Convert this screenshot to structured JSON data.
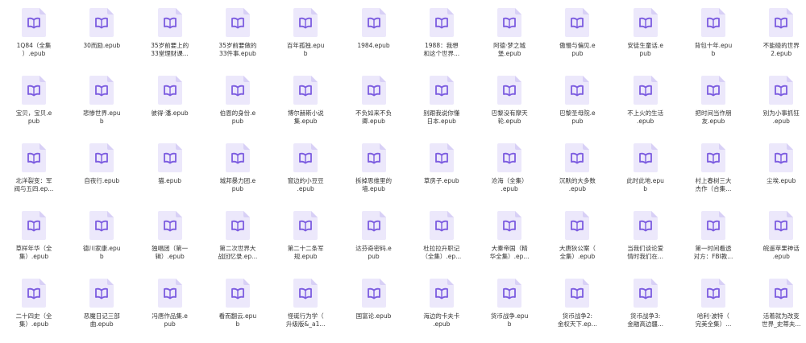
{
  "files": [
    {
      "name": "1Q84（全集\n）.epub"
    },
    {
      "name": "30而励.epub"
    },
    {
      "name": "35岁前要上的\n33堂理财课..."
    },
    {
      "name": "35岁前要做的\n33件事.epub"
    },
    {
      "name": "百年孤独.epu\nb"
    },
    {
      "name": "1984.epub"
    },
    {
      "name": "1988：我想\n和这个世界..."
    },
    {
      "name": "阿德·梦之城\n堡.epub"
    },
    {
      "name": "傲慢与偏见.e\npub"
    },
    {
      "name": "安徒生童话.e\npub"
    },
    {
      "name": "背包十年.epu\nb"
    },
    {
      "name": "不能碰的世界\n2.epub"
    },
    {
      "name": "宝贝，宝贝.e\npub"
    },
    {
      "name": "悲惨世界.epu\nb"
    },
    {
      "name": "彼得·潘.epub"
    },
    {
      "name": "伯恩的身份.e\npub"
    },
    {
      "name": "博尔赫斯小说\n集.epub"
    },
    {
      "name": "不负如来不负\n卿.epub"
    },
    {
      "name": "别跟我说你懂\n日本.epub"
    },
    {
      "name": "巴黎没有摩天\n轮.epub"
    },
    {
      "name": "巴黎圣母院.e\npub"
    },
    {
      "name": "不上火的生活\n.epub"
    },
    {
      "name": "把时间当作朋\n友.epub"
    },
    {
      "name": "别为小事抓狂\n.epub"
    },
    {
      "name": "北洋裂变：军\n阀与五四.ep..."
    },
    {
      "name": "自夜行.epub"
    },
    {
      "name": "猫.epub"
    },
    {
      "name": "城邦暴力团.e\npub"
    },
    {
      "name": "窗边的小豆豆\n.epub"
    },
    {
      "name": "拆掉思维里的\n墙.epub"
    },
    {
      "name": "草房子.epub"
    },
    {
      "name": "沧海（全集）\n.epub"
    },
    {
      "name": "沉默的大多数\n.epub"
    },
    {
      "name": "此时此地.epu\nb"
    },
    {
      "name": "村上春树三大\n杰作（合集..."
    },
    {
      "name": "尘埃.epub"
    },
    {
      "name": "草样年华（全\n集）.epub"
    },
    {
      "name": "德川家康.epu\nb"
    },
    {
      "name": "独唱团（第一\n辑）.epub"
    },
    {
      "name": "第二次世界大\n战回忆录.ep..."
    },
    {
      "name": "第二十二条军\n规.epub"
    },
    {
      "name": "达芬奇密码.e\npub"
    },
    {
      "name": "杜拉拉升职记\n（全集）.ep..."
    },
    {
      "name": "大秦帝国（精\n华全集）.ep..."
    },
    {
      "name": "大唐狄公案（\n全集）.epub"
    },
    {
      "name": "当我们谈论爱\n情时我们在..."
    },
    {
      "name": "第一时间看透\n对方：FBI教..."
    },
    {
      "name": "皖遥苹果神话\n.epub"
    },
    {
      "name": "二十四史（全\n集）.epub"
    },
    {
      "name": "恶魔日记三部\n曲.epub"
    },
    {
      "name": "冯唐作品集.e\npub"
    },
    {
      "name": "看而翻云.epu\nb"
    },
    {
      "name": "怪诞行为学（\n升级版&_a1..."
    },
    {
      "name": "国富论.epub"
    },
    {
      "name": "海边的卡夫卡\n.epub"
    },
    {
      "name": "货币战争.epu\nb"
    },
    {
      "name": "货币战争2:\n金权天下.ep..."
    },
    {
      "name": "货币战争3:\n金融高边疆..."
    },
    {
      "name": "哈利·波特（\n完美全集）..."
    },
    {
      "name": "活着就为改变\n世界_史蒂夫..."
    }
  ],
  "colors": {
    "icon_fill": "#ece8fb",
    "icon_fold": "#d8d0f6",
    "icon_glyph": "#7c5ce0",
    "text": "#333333"
  }
}
